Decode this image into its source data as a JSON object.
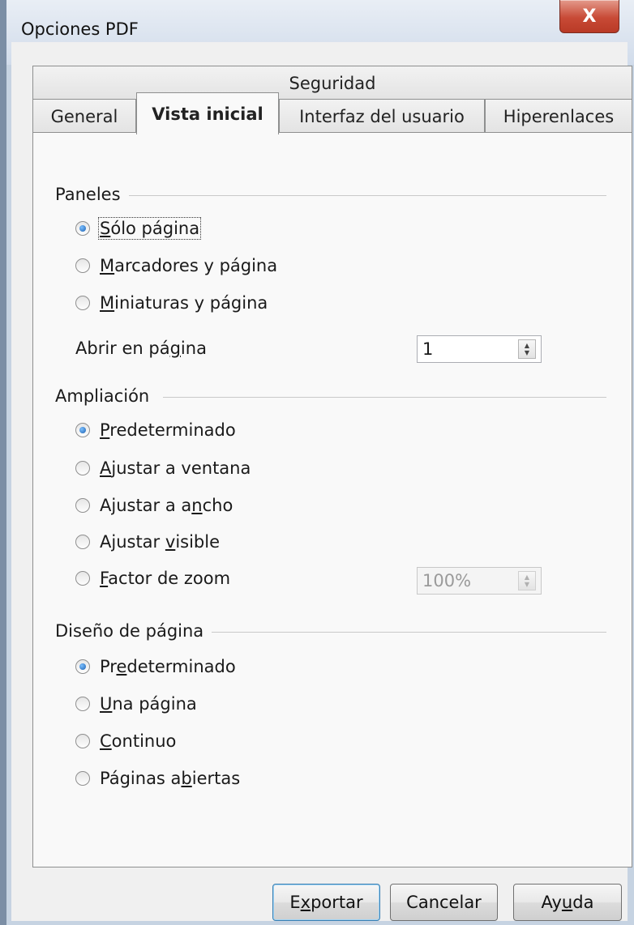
{
  "window": {
    "title": "Opciones PDF",
    "close_glyph": "X"
  },
  "tabs": {
    "security": "Seguridad",
    "general": "General",
    "initial_view": "Vista inicial",
    "user_interface": "Interfaz del usuario",
    "hyperlinks": "Hiperenlaces"
  },
  "panels": {
    "title": "Paneles",
    "options": [
      {
        "pre": "",
        "acc": "S",
        "post": "ólo página",
        "checked": true
      },
      {
        "pre": "",
        "acc": "M",
        "post": "arcadores y página",
        "checked": false
      },
      {
        "pre": "",
        "acc": "M",
        "post": "iniaturas y página",
        "checked": false
      }
    ],
    "open_page_label_pre": "Abrir en pá",
    "open_page_label_acc": "g",
    "open_page_label_post": "ina",
    "open_page_value": "1"
  },
  "magnification": {
    "title": "Ampliación",
    "options": [
      {
        "pre": "",
        "acc": "P",
        "post": "redeterminado",
        "checked": true
      },
      {
        "pre": "",
        "acc": "A",
        "post": "justar a ventana",
        "checked": false
      },
      {
        "pre": "Ajustar a a",
        "acc": "n",
        "post": "cho",
        "checked": false
      },
      {
        "pre": "Ajustar ",
        "acc": "v",
        "post": "isible",
        "checked": false
      },
      {
        "pre": "",
        "acc": "F",
        "post": "actor de zoom",
        "checked": false
      }
    ],
    "zoom_value": "100%"
  },
  "page_layout": {
    "title": "Diseño de página",
    "options": [
      {
        "pre": "Pr",
        "acc": "e",
        "post": "determinado",
        "checked": true
      },
      {
        "pre": "",
        "acc": "U",
        "post": "na página",
        "checked": false
      },
      {
        "pre": "",
        "acc": "C",
        "post": "ontinuo",
        "checked": false
      },
      {
        "pre": "Páginas a",
        "acc": "b",
        "post": "iertas",
        "checked": false
      }
    ]
  },
  "buttons": {
    "export": {
      "pre": "E",
      "acc": "x",
      "post": "portar"
    },
    "cancel": "Cancelar",
    "help": {
      "pre": "Ay",
      "acc": "u",
      "post": "da"
    }
  }
}
